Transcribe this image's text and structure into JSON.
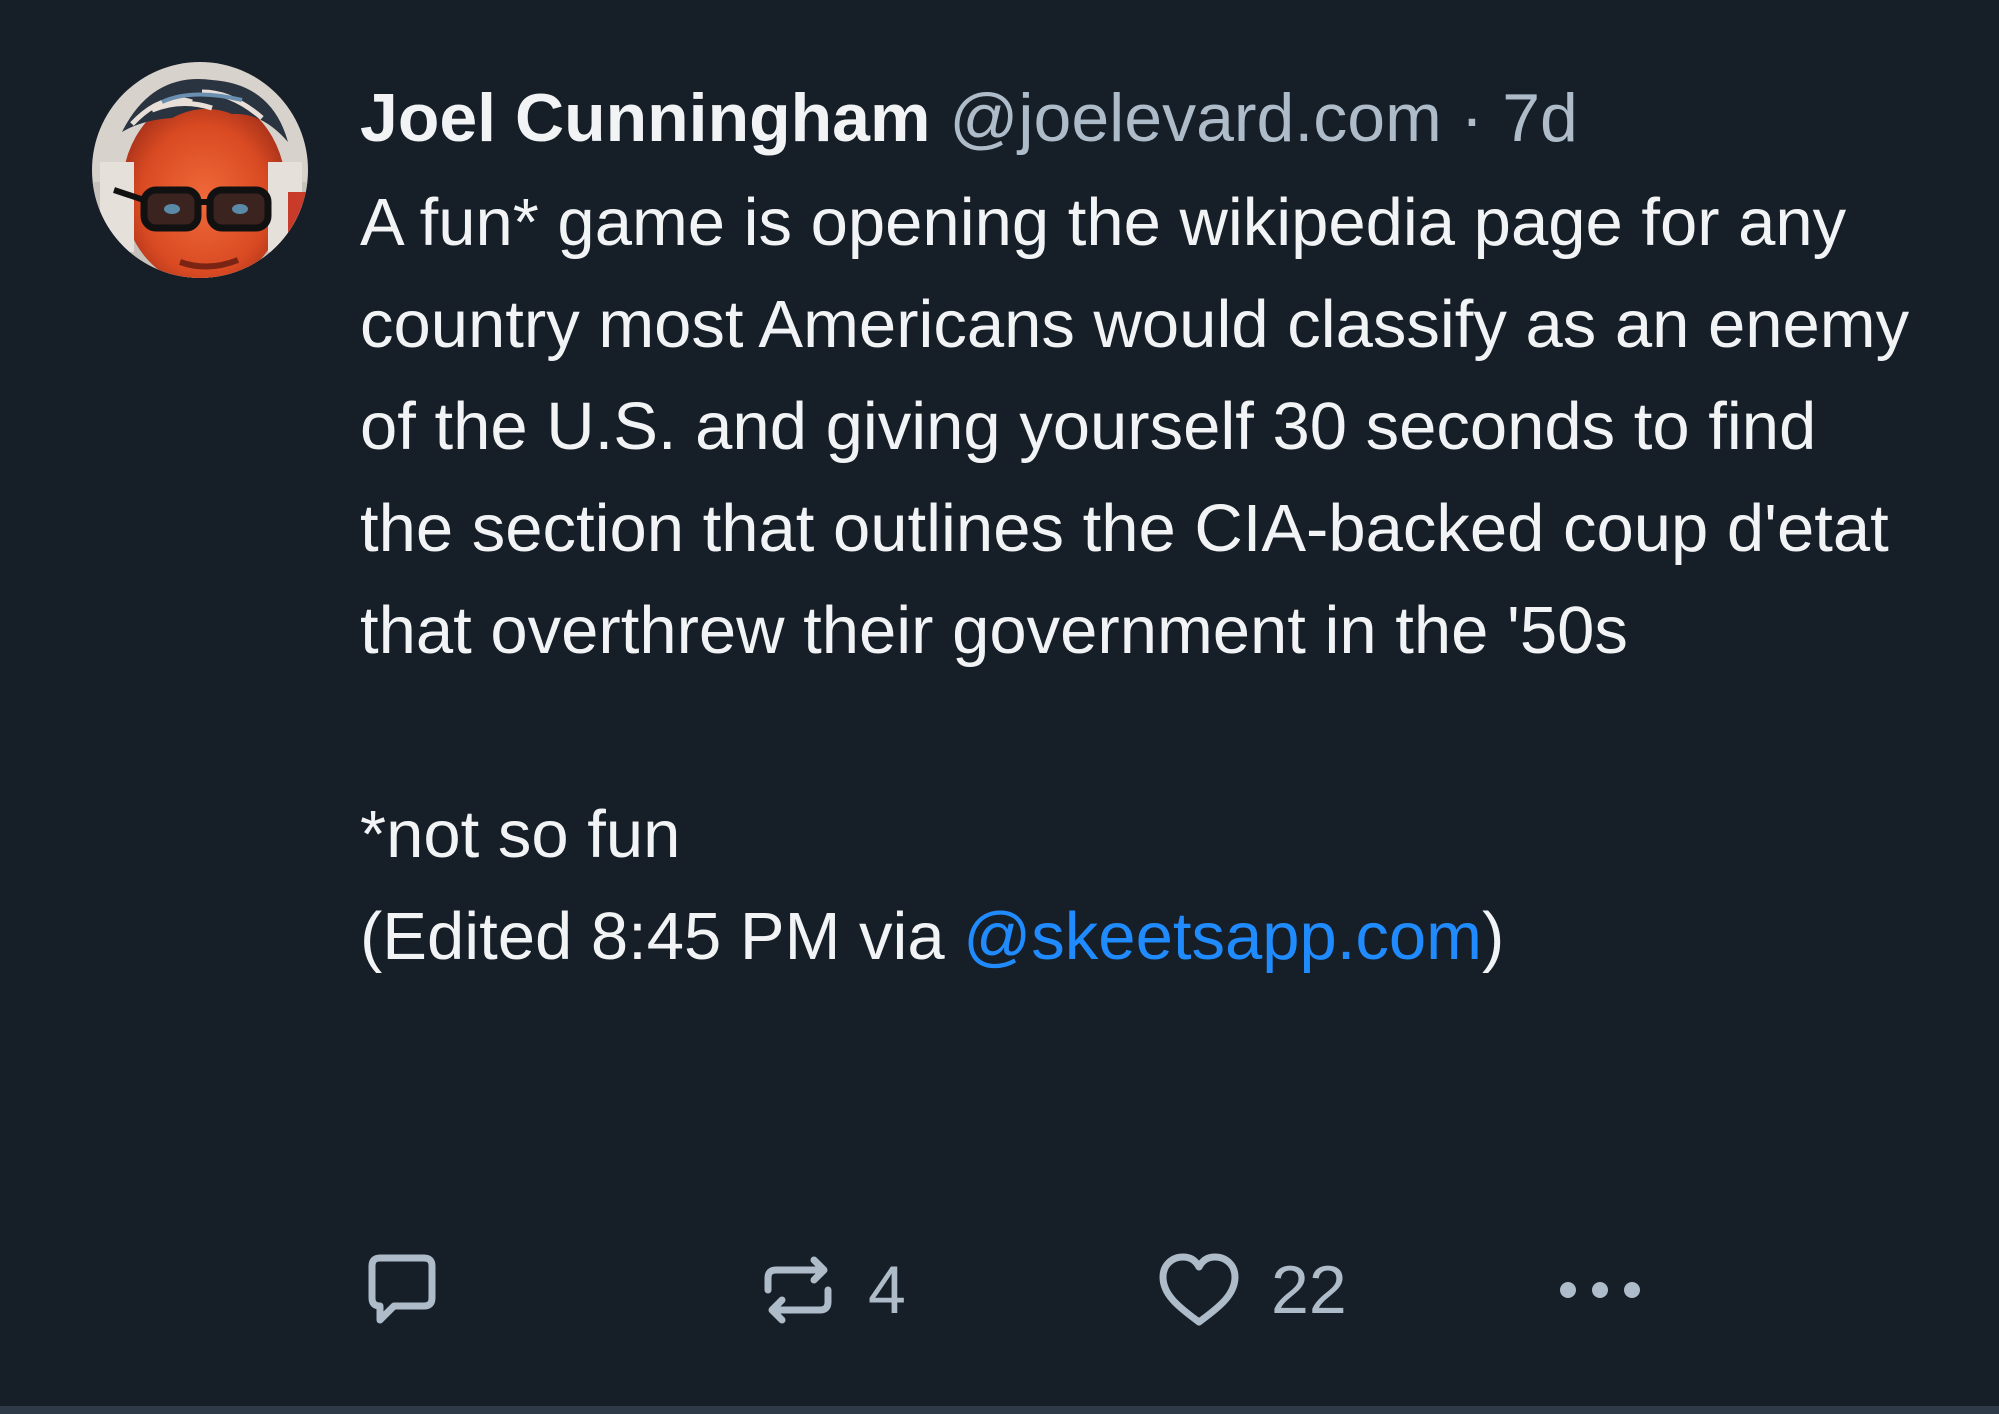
{
  "post": {
    "author": {
      "display_name": "Joel Cunningham",
      "handle": "@joelevard.com",
      "separator": "·",
      "timestamp": "7d"
    },
    "text_lines": [
      "A fun* game is opening the wikipedia page for any country most Americans would classify as an enemy of the U.S. and giving yourself 30 seconds to find the section that outlines the CIA-backed coup d'etat that overthrew their government in the '50s",
      "*not so fun"
    ],
    "edited": {
      "prefix": "(Edited 8:45 PM via ",
      "link_text": "@skeetsapp.com",
      "suffix": ")"
    },
    "actions": {
      "reply_icon": "reply-bubble-icon",
      "repost_icon": "repost-icon",
      "repost_count": "4",
      "like_icon": "heart-icon",
      "like_count": "22",
      "more_icon": "ellipsis-icon"
    }
  },
  "colors": {
    "background": "#161e27",
    "text": "#f1f3f5",
    "muted": "#aebbc9",
    "link": "#208bfe"
  }
}
